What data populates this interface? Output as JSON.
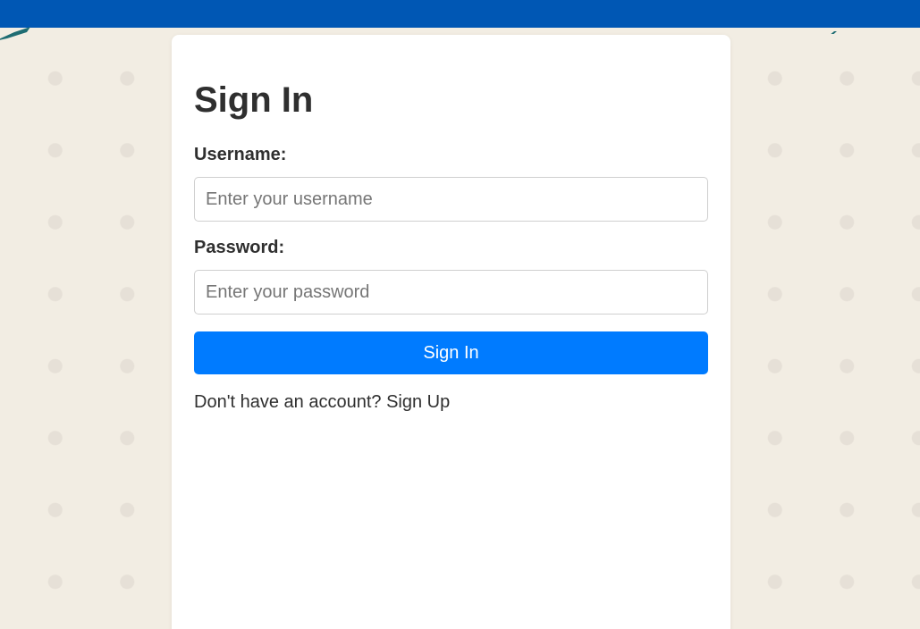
{
  "header": {
    "bar_color": "#0057b4"
  },
  "form": {
    "title": "Sign In",
    "username_label": "Username:",
    "username_placeholder": "Enter your username",
    "username_value": "",
    "password_label": "Password:",
    "password_placeholder": "Enter your password",
    "password_value": "",
    "submit_label": "Sign In",
    "submit_color": "#007bff",
    "signup_prompt": "Don't have an account?",
    "signup_link": "Sign Up"
  }
}
